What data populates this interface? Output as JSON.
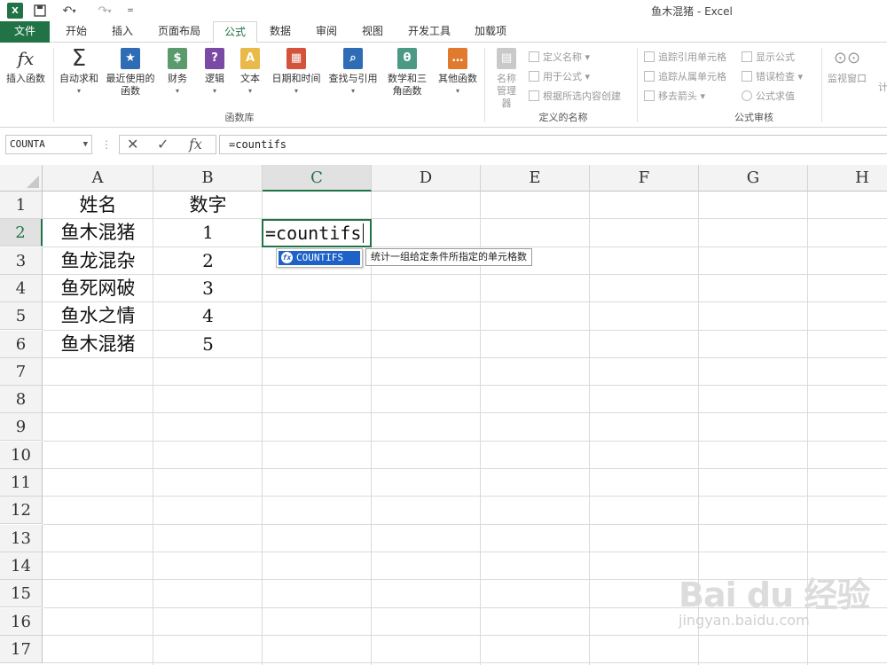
{
  "titlebar": {
    "title": "鱼木混猪 - Excel",
    "undo_symbol": "↶",
    "redo_symbol": "↷",
    "customize_symbol": "="
  },
  "tabs": [
    "文件",
    "开始",
    "插入",
    "页面布局",
    "公式",
    "数据",
    "审阅",
    "视图",
    "开发工具",
    "加载项"
  ],
  "active_tab": "公式",
  "ribbon": {
    "function_library": {
      "label": "函数库",
      "buttons": [
        {
          "label": "插入函数",
          "icon": "fx-icon"
        },
        {
          "label": "自动求和",
          "icon": "sigma-icon"
        },
        {
          "label": "最近使用的函数",
          "icon": "star-book-icon"
        },
        {
          "label": "财务",
          "icon": "finance-book-icon"
        },
        {
          "label": "逻辑",
          "icon": "logic-book-icon"
        },
        {
          "label": "文本",
          "icon": "text-book-icon"
        },
        {
          "label": "日期和时间",
          "icon": "calendar-book-icon"
        },
        {
          "label": "查找与引用",
          "icon": "lookup-book-icon"
        },
        {
          "label": "数学和三角函数",
          "icon": "math-book-icon"
        },
        {
          "label": "其他函数",
          "icon": "more-book-icon"
        }
      ]
    },
    "defined_names": {
      "label": "定义的名称",
      "name_manager": "名称管理器",
      "items": [
        "定义名称",
        "用于公式",
        "根据所选内容创建"
      ]
    },
    "formula_auditing": {
      "label": "公式审核",
      "items": [
        "追踪引用单元格",
        "追踪从属单元格",
        "移去箭头",
        "显示公式",
        "错误检查",
        "公式求值"
      ],
      "watch_window": "监视窗口",
      "partial_cut": "计"
    }
  },
  "formula_bar": {
    "name_box": "COUNTA",
    "fx_symbol": "fx",
    "formula": "=countifs"
  },
  "grid": {
    "columns": [
      "A",
      "B",
      "C",
      "D",
      "E",
      "F",
      "G",
      "H"
    ],
    "rows": [
      "1",
      "2",
      "3",
      "4",
      "5",
      "6",
      "7",
      "8",
      "9",
      "10",
      "11",
      "12",
      "13",
      "14",
      "15",
      "16",
      "17"
    ],
    "cells": [
      [
        "姓名",
        "数字"
      ],
      [
        "鱼木混猪",
        "1"
      ],
      [
        "鱼龙混杂",
        "2"
      ],
      [
        "鱼死网破",
        "3"
      ],
      [
        "鱼水之情",
        "4"
      ],
      [
        "鱼木混猪",
        "5"
      ]
    ],
    "active_cell_text": "=countifs",
    "selected_column": "C",
    "selected_row": "2"
  },
  "autocomplete": {
    "item": "COUNTIFS",
    "tooltip": "统计一组给定条件所指定的单元格数"
  },
  "watermark": {
    "logo": "Bai du 经验",
    "url": "jingyan.baidu.com"
  },
  "colors": {
    "accent": "#217346",
    "highlight": "#1e62c7"
  }
}
